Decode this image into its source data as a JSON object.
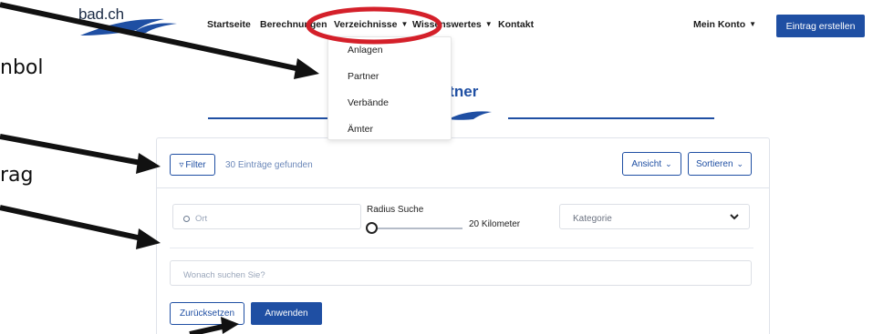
{
  "logo": {
    "text": "bad.ch"
  },
  "nav": {
    "items": [
      {
        "label": "Startseite"
      },
      {
        "label": "Berechnungen"
      },
      {
        "label": "Verzeichnisse"
      },
      {
        "label": "Wissenswertes"
      },
      {
        "label": "Kontakt"
      }
    ],
    "account_label": "Mein Konto",
    "create_entry_label": "Eintrag erstellen"
  },
  "dropdown": {
    "items": [
      {
        "label": "Anlagen"
      },
      {
        "label": "Partner"
      },
      {
        "label": "Verbände"
      },
      {
        "label": "Ämter"
      }
    ]
  },
  "page": {
    "title_visible": "rtner"
  },
  "filter_bar": {
    "filter_label": "Filter",
    "count_text": "30 Einträge gefunden",
    "view_label": "Ansicht",
    "sort_label": "Sortieren"
  },
  "filters": {
    "location_placeholder": "Ort",
    "radius_label": "Radius Suche",
    "radius_value": "20 Kilometer",
    "category_label": "Kategorie",
    "search_placeholder": "Wonach suchen Sie?",
    "reset_label": "Zurücksetzen",
    "apply_label": "Anwenden"
  },
  "annotations": {
    "text_1": "nbol",
    "text_2": "rag"
  },
  "colors": {
    "primary": "#1f4fa3",
    "highlight_ring": "#d4202a",
    "muted_text": "#6b87b8"
  },
  "icons": [
    "logo-wave-icon",
    "chevron-down-icon",
    "filter-icon",
    "location-circle-icon",
    "arrow-icon"
  ]
}
